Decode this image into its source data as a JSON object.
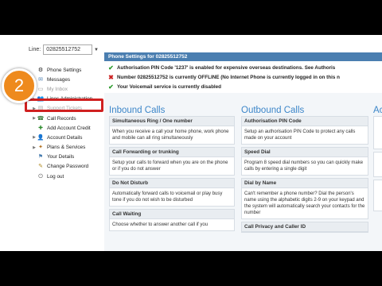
{
  "line_selector": {
    "label": "Line:",
    "value": "02825512752"
  },
  "nav": {
    "items": [
      {
        "label": "Phone Settings",
        "icon": "gear-phone-icon"
      },
      {
        "label": "Messages",
        "icon": "messages-icon"
      },
      {
        "label": "My Inbox",
        "icon": "inbox-icon"
      },
      {
        "label": "Lines Administration",
        "icon": "users-icon"
      },
      {
        "label": "Support Tickets",
        "icon": "ticket-icon"
      },
      {
        "label": "Call Records",
        "icon": "call-records-icon"
      },
      {
        "label": "Add Account Credit",
        "icon": "add-credit-icon"
      },
      {
        "label": "Account Details",
        "icon": "account-icon"
      },
      {
        "label": "Plans & Services",
        "icon": "plans-icon"
      },
      {
        "label": "Your Details",
        "icon": "details-icon"
      },
      {
        "label": "Change Password",
        "icon": "password-icon"
      },
      {
        "label": "Log out",
        "icon": "logout-icon"
      }
    ]
  },
  "callout": {
    "step": "2"
  },
  "main": {
    "title": "Phone Settings for 02825512752",
    "alerts": [
      {
        "text": "Authorisation PIN Code '1237' is enabled for expensive overseas destinations. See Authoris",
        "type": "ok"
      },
      {
        "text": "Number 02825512752 is currently OFFLINE (No Internet Phone is currently logged in on this n",
        "type": "error"
      },
      {
        "text": "Your Voicemail service is currently disabled",
        "type": "ok"
      }
    ],
    "inbound": {
      "heading": "Inbound Calls",
      "cards": [
        {
          "title": "Simultaneous Ring / One number",
          "body": "When you receive a call your home phone, work phone and mobile can all ring simultaneously"
        },
        {
          "title": "Call Forwarding or trunking",
          "body": "Setup your calls to forward when you are on the phone or if you do not answer"
        },
        {
          "title": "Do Not Disturb",
          "body": "Automatically forward calls to voicemail or play busy tone if you do not wish to be disturbed"
        },
        {
          "title": "Call Waiting",
          "body": "Choose whether to answer another call if you"
        }
      ]
    },
    "outbound": {
      "heading": "Outbound Calls",
      "cards": [
        {
          "title": "Authorisation PIN Code",
          "body": "Setup an authorisation PIN Code to protect any calls made on your account"
        },
        {
          "title": "Speed Dial",
          "body": "Program 8 speed dial numbers so you can quickly make calls by entering a single digit"
        },
        {
          "title": "Dial by Name",
          "body": "Can't remember a phone number? Dial the person's name using the alphabetic digits 2-9 on your keypad and the system will automatically search your contacts for the number"
        },
        {
          "title": "Call Privacy and Caller ID",
          "body": ""
        }
      ]
    },
    "third": {
      "heading": "Ac"
    }
  }
}
